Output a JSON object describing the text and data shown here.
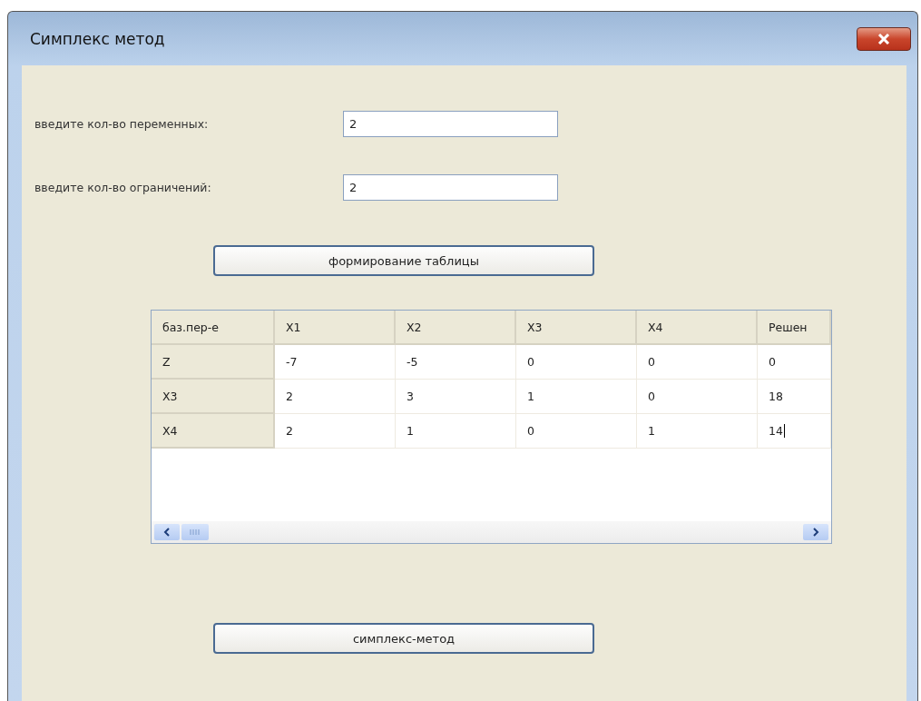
{
  "window": {
    "title": "Симплекс метод"
  },
  "fields": [
    {
      "label": "введите кол-во переменных:",
      "value": "2"
    },
    {
      "label": "введите кол-во ограничений:",
      "value": "2"
    }
  ],
  "build_button": "формирование таблицы",
  "table": {
    "corner": "баз.пер-е",
    "columns": [
      "X1",
      "X2",
      "X3",
      "X4",
      "Решен"
    ],
    "rows": [
      {
        "header": "Z",
        "cells": [
          {
            "text": "-7",
            "editing": false
          },
          {
            "text": "-5",
            "editing": false
          },
          {
            "text": "0",
            "editing": false
          },
          {
            "text": "0",
            "editing": false
          },
          {
            "text": "0",
            "editing": false
          }
        ]
      },
      {
        "header": "X3",
        "cells": [
          {
            "text": "2",
            "editing": false
          },
          {
            "text": "3",
            "editing": false
          },
          {
            "text": "1",
            "editing": false
          },
          {
            "text": "0",
            "editing": false
          },
          {
            "text": "18",
            "editing": false
          }
        ]
      },
      {
        "header": "X4",
        "cells": [
          {
            "text": "2",
            "editing": false
          },
          {
            "text": "1",
            "editing": false
          },
          {
            "text": "0",
            "editing": false
          },
          {
            "text": "1",
            "editing": false
          },
          {
            "text": "14",
            "editing": true
          }
        ]
      }
    ]
  },
  "solve_button": "симплекс-метод"
}
